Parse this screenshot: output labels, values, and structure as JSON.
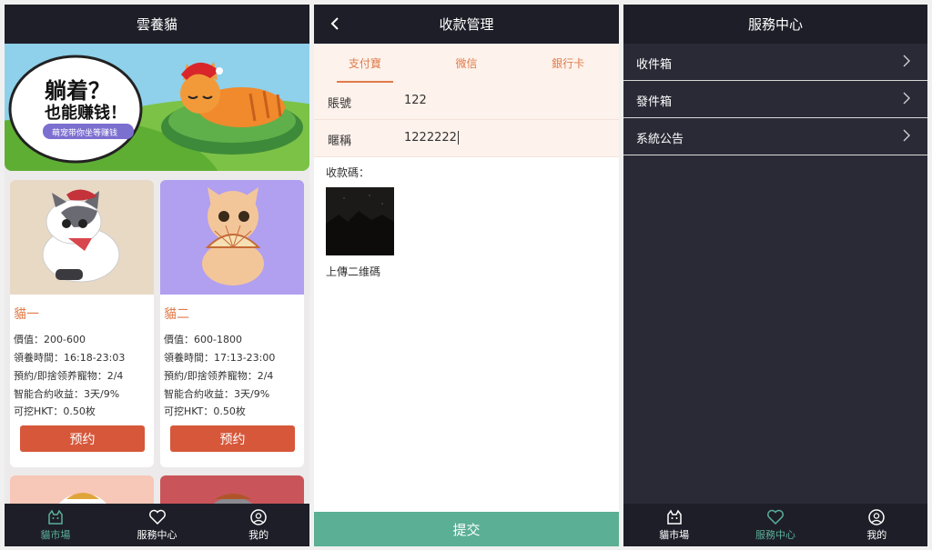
{
  "panel_market": {
    "title": "雲養貓",
    "banner": {
      "headline1": "躺着？",
      "headline2": "也能赚钱！",
      "subline": "萌宠带你坐等赚钱"
    },
    "cards": [
      {
        "name": "貓一",
        "value": "價值：200-600",
        "adopt_time": "領養時間：16:18-23:03",
        "reserve": "預約/即捨领养寵物：2/4",
        "contract": "智能合約收益：3天/9%",
        "mine": "可挖HKT：0.50枚",
        "button": "预约",
        "bg": "#e8d9c5"
      },
      {
        "name": "貓二",
        "value": "價值：600-1800",
        "adopt_time": "領養時間：17:13-23:00",
        "reserve": "預約/即捨领养寵物：2/4",
        "contract": "智能合約收益：3天/9%",
        "mine": "可挖HKT：0.50枚",
        "button": "预约",
        "bg": "#b19ff0"
      }
    ],
    "tabbar": [
      {
        "label": "貓市場",
        "icon": "cat-icon",
        "active": true
      },
      {
        "label": "服務中心",
        "icon": "heart-icon",
        "active": false
      },
      {
        "label": "我的",
        "icon": "user-icon",
        "active": false
      }
    ]
  },
  "panel_payment": {
    "title": "收款管理",
    "segments": [
      "支付寶",
      "微信",
      "銀行卡"
    ],
    "active_segment": "支付寶",
    "fields": [
      {
        "label": "賬號",
        "value": "122"
      },
      {
        "label": "暱稱",
        "value": "1222222"
      }
    ],
    "qr_label": "收款碼：",
    "upload_label": "上傳二维碼",
    "submit": "提交"
  },
  "panel_service": {
    "title": "服務中心",
    "items": [
      "收件箱",
      "發件箱",
      "系統公告"
    ],
    "tabbar": [
      {
        "label": "貓市場",
        "icon": "cat-icon",
        "active": false
      },
      {
        "label": "服務中心",
        "icon": "heart-icon",
        "active": true
      },
      {
        "label": "我的",
        "icon": "user-icon",
        "active": false
      }
    ]
  },
  "colors": {
    "dark_bar": "#1e1e28",
    "accent_orange": "#e07b4a",
    "button_red": "#d6573a",
    "accent_green": "#5aaf94",
    "service_bg": "#2a2a37"
  }
}
